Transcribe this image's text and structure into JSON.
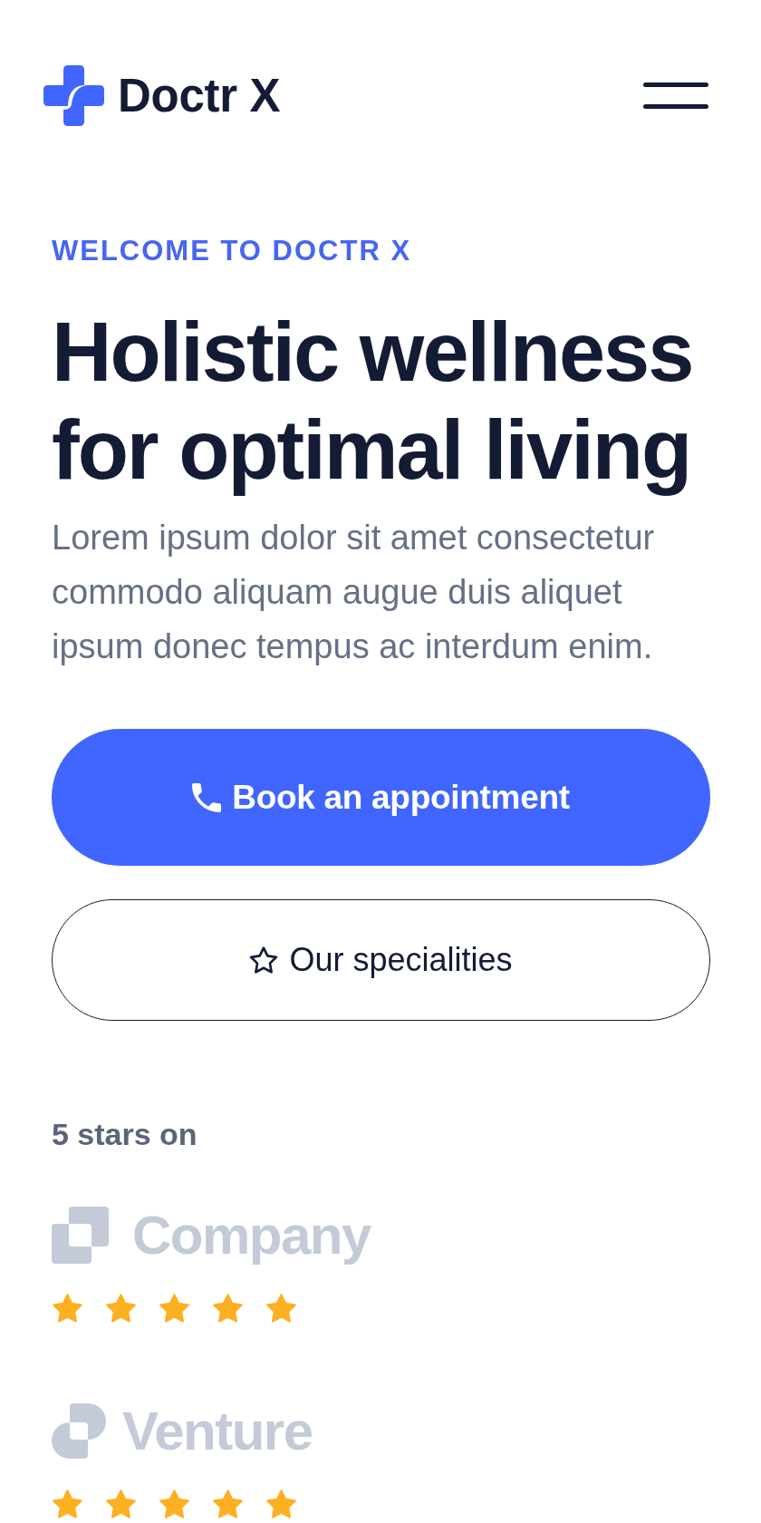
{
  "header": {
    "brand": "Doctr X"
  },
  "hero": {
    "eyebrow": "WELCOME TO DOCTR X",
    "title": "Holistic wellness for optimal living",
    "description": "Lorem ipsum dolor sit amet consectetur commodo aliquam augue duis aliquet ipsum donec tempus ac interdum enim.",
    "buttons": [
      {
        "label": "Book an appointment",
        "kind": "primary"
      },
      {
        "label": "Our specialities",
        "kind": "outline"
      }
    ]
  },
  "ratings": {
    "heading": "5 stars on",
    "platforms": [
      {
        "name": "Company",
        "kind": "squares",
        "stars": 5
      },
      {
        "name": "Venture",
        "kind": "rounded",
        "stars": 5
      }
    ]
  }
}
